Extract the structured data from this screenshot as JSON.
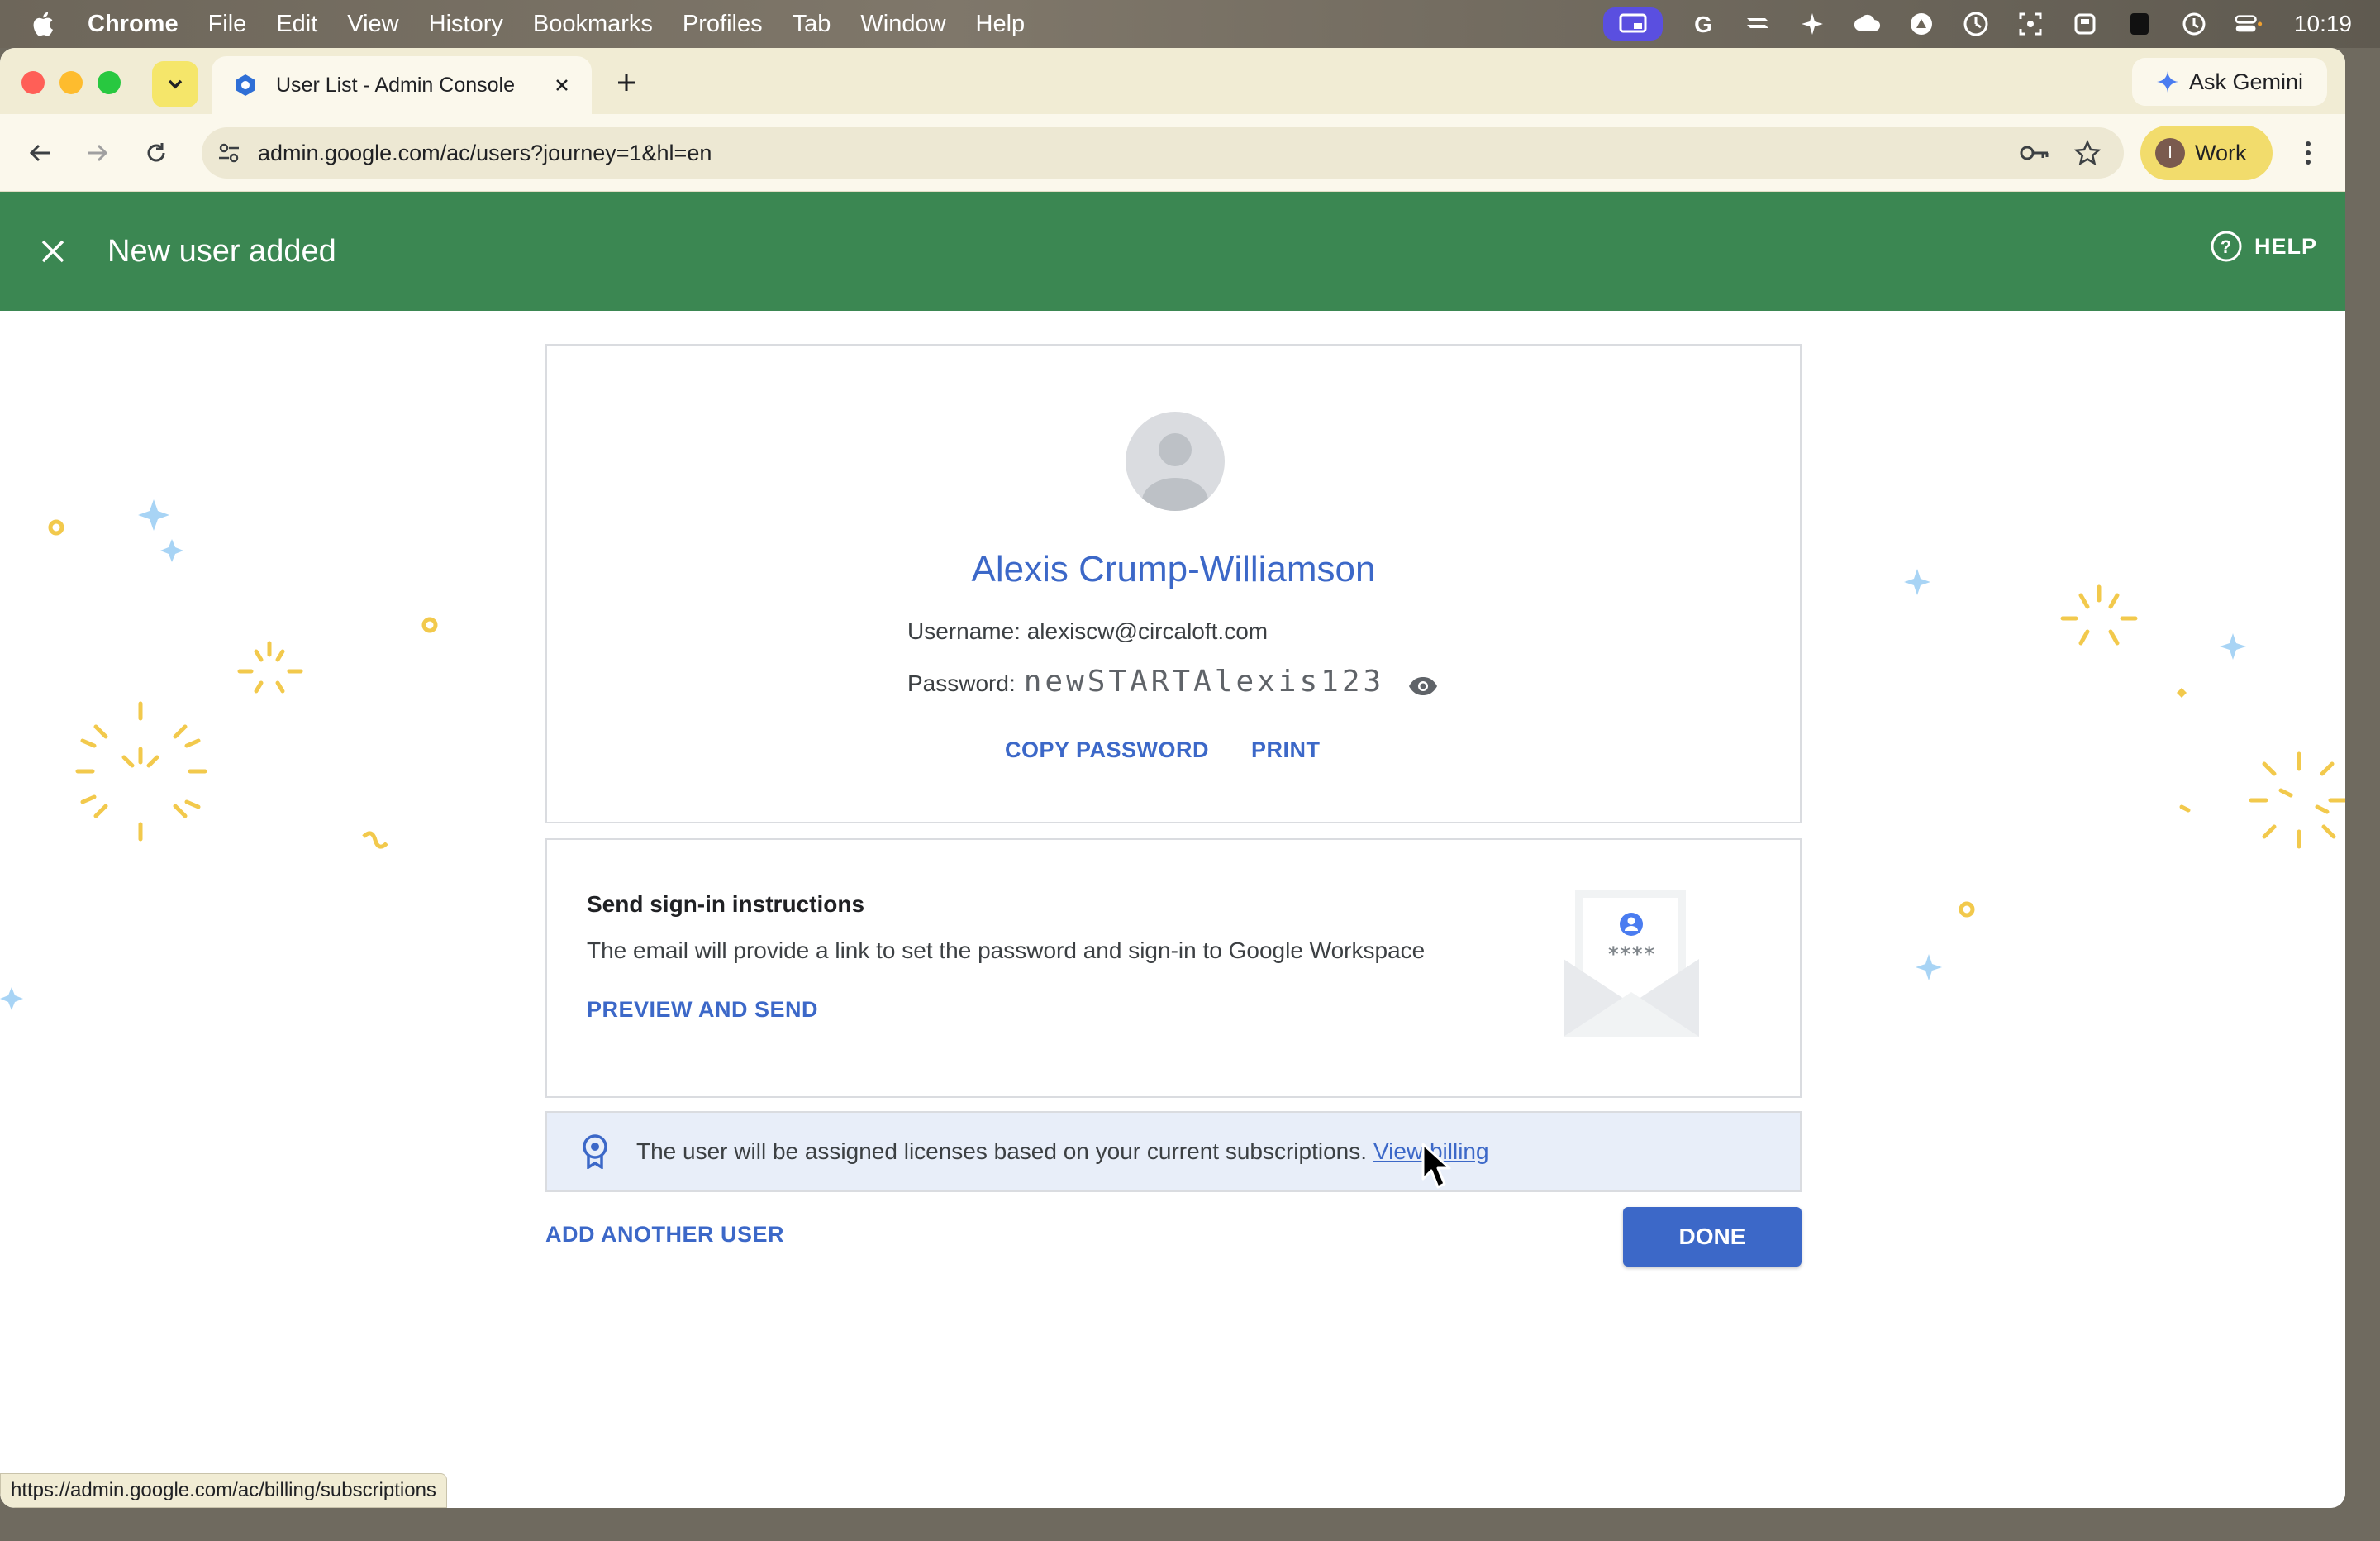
{
  "menubar": {
    "app": "Chrome",
    "items": [
      "File",
      "Edit",
      "View",
      "History",
      "Bookmarks",
      "Profiles",
      "Tab",
      "Window",
      "Help"
    ],
    "clock": "10:19"
  },
  "browser": {
    "tab_title": "User List - Admin Console",
    "ask_gemini": "Ask Gemini",
    "url": "admin.google.com/ac/users?journey=1&hl=en",
    "profile_initial": "I",
    "profile_label": "Work",
    "status_url": "https://admin.google.com/ac/billing/subscriptions"
  },
  "appbar": {
    "title": "New user added",
    "help_label": "HELP"
  },
  "user_card": {
    "name": "Alexis Crump-Williamson",
    "username_label": "Username:",
    "username": "alexiscw@circaloft.com",
    "password_label": "Password:",
    "password": "newSTARTAlexis123",
    "copy_password": "COPY PASSWORD",
    "print": "PRINT"
  },
  "send_card": {
    "heading": "Send sign-in instructions",
    "description": "The email will provide a link to set the password and sign-in to Google Workspace",
    "preview_and_send": "PREVIEW AND SEND",
    "envelope_stars": "****"
  },
  "license_banner": {
    "text": "The user will be assigned licenses based on your current subscriptions.",
    "link": "View billing"
  },
  "footer": {
    "add_another": "ADD ANOTHER USER",
    "done": "DONE"
  },
  "colors": {
    "appbar_green": "#3b8752",
    "accent_blue": "#3c68c8",
    "banner_bg": "#e8eef9"
  }
}
